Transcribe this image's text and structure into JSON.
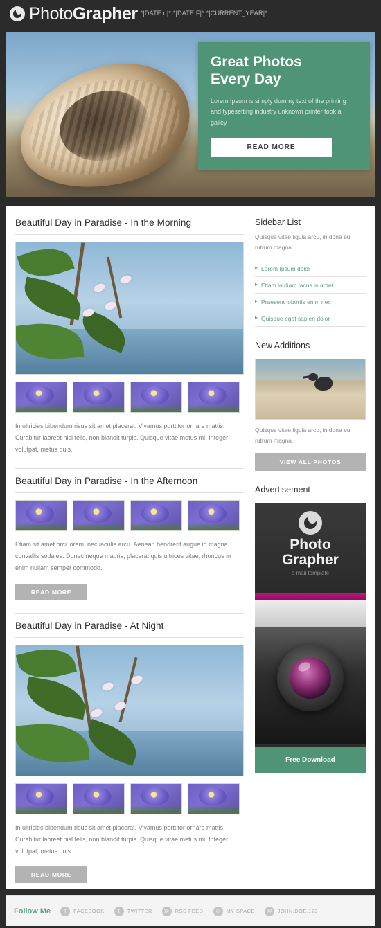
{
  "header": {
    "logo_light": "Photo",
    "logo_bold": "Grapher",
    "date_tokens": "*|DATE:d|* *|DATE:F|* *|CURRENT_YEAR|*"
  },
  "hero": {
    "title_line1": "Great Photos",
    "title_line2": "Every Day",
    "description": "Lorem Ipsum is simply dummy text of the printing and typesetting industry unknown printer took a galley",
    "button": "READ MORE",
    "accent_color": "#4f9477"
  },
  "articles": [
    {
      "title": "Beautiful Day in Paradise - In the Morning",
      "body": "In ultricies bibendum risus sit amet placerat. Vivamus porttitor ornare mattis. Curabitur laoreet nisl felis, non blandit turpis. Quisque vitae metus mi. Integer volutpat, metus quis.",
      "has_hero_photo": true,
      "thumb_count": 4,
      "button": ""
    },
    {
      "title": "Beautiful Day in Paradise - In the Afternoon",
      "body": "Etiam sit amet orci lorem, nec iaculis arcu. Aenean hendrerit augue id magna convallis sodales. Donec neque mauris, placerat quis ultrices vitae, rhoncus in enim nullam semper commodo.",
      "has_hero_photo": false,
      "thumb_count": 4,
      "button": "READ MORE"
    },
    {
      "title": "Beautiful Day in Paradise - At Night",
      "body": "In ultricies bibendum risus sit amet placerat. Vivamus porttitor ornare mattis. Curabitur laoreet nisl felis, non blandit turpis. Quisque vitae metus mi. Integer volutpat, metus quis.",
      "has_hero_photo": true,
      "thumb_count": 4,
      "button": "READ MORE"
    }
  ],
  "sidebar": {
    "list_title": "Sidebar List",
    "list_intro": "Quisque vitae ligula arcu, in dona eu rutrum magna.",
    "links": [
      "Lorem Ipsum dolor",
      "Etiam in diam lacus in amet",
      "Praesent lobortis enim nec",
      "Quisque eget sapien dolor"
    ],
    "additions_title": "New Additions",
    "additions_caption": "Quisque vitae ligula arcu, in dona eu rutrum magna.",
    "additions_button": "VIEW ALL PHOTOS",
    "ad_title": "Advertisement",
    "ad": {
      "name_line1": "Photo",
      "name_line2": "Grapher",
      "tagline": "a mail template",
      "button": "Free Download"
    }
  },
  "footer": {
    "follow_label": "Follow Me",
    "socials": [
      {
        "glyph": "f",
        "label": "FACEBOOK"
      },
      {
        "glyph": "t",
        "label": "TWITTER"
      },
      {
        "glyph": "≫",
        "label": "RSS FEED"
      },
      {
        "glyph": "☺",
        "label": "MY SPACE"
      },
      {
        "glyph": "@",
        "label": "JOHN.DOE.123"
      }
    ]
  }
}
